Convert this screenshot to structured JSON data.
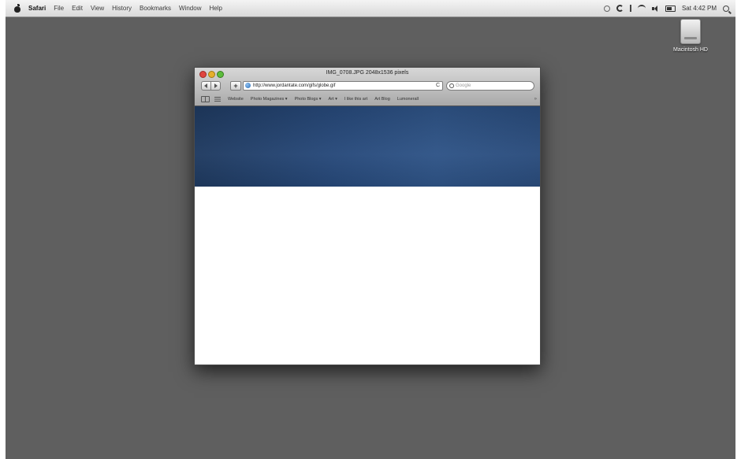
{
  "menubar": {
    "app_name": "Safari",
    "items": [
      "File",
      "Edit",
      "View",
      "History",
      "Bookmarks",
      "Window",
      "Help"
    ],
    "clock": "Sat 4:42 PM"
  },
  "desktop": {
    "hd_label": "Macintosh HD"
  },
  "window": {
    "title": "IMG_0708.JPG 2048x1536 pixels",
    "url": "http://www.jordantate.com/gifs/globe.gif",
    "search_placeholder": "Google",
    "bookmarks": [
      "Website",
      "Photo Magazines ▾",
      "Photo Blogs ▾",
      "Art ▾",
      "I like this art",
      "Art Blog",
      "Lumonerall"
    ],
    "more_glyph": "»"
  },
  "colors": {
    "desktop": "#5f5f5f",
    "photo_blue": "#2a4c7c"
  }
}
